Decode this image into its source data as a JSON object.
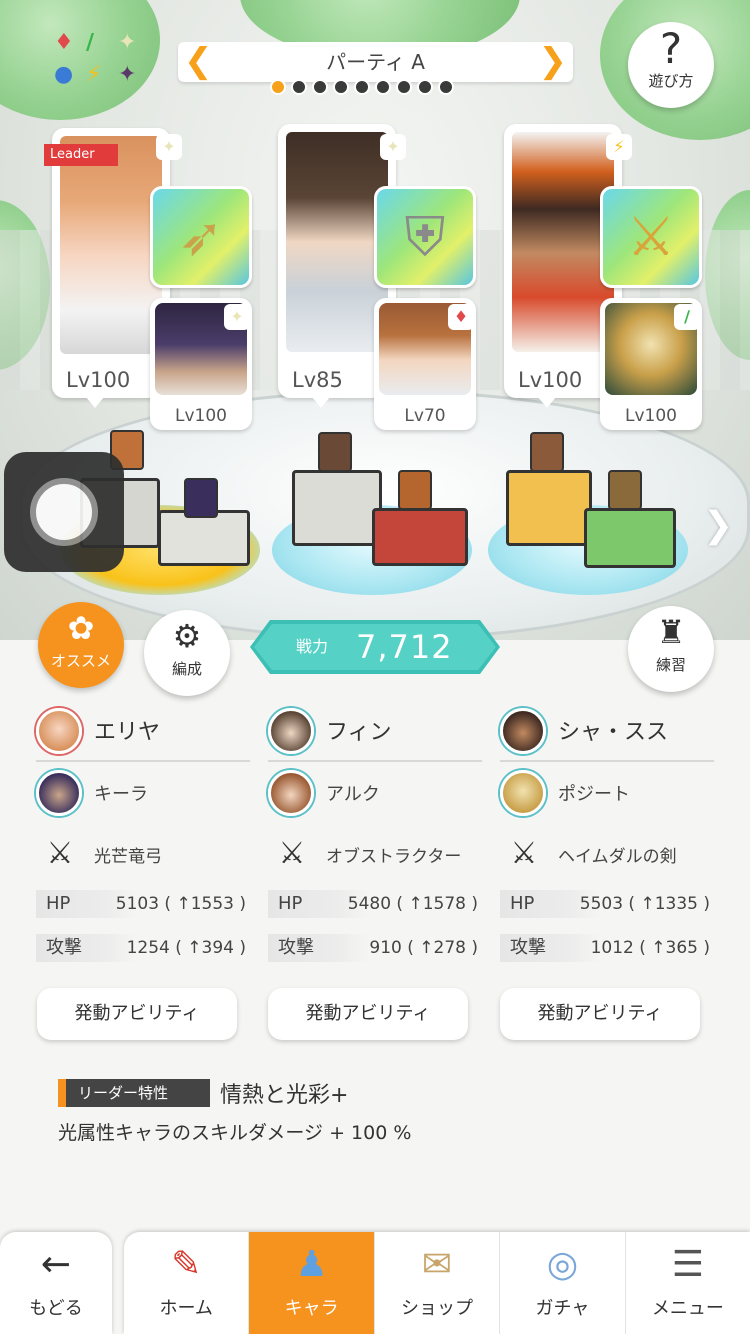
{
  "header": {
    "party_name": "パーティ A",
    "prev_arrow": "❮",
    "next_arrow": "❯",
    "page_count": 9,
    "active_page": 1,
    "help_label": "遊び方",
    "help_icon": "?"
  },
  "element_icons": [
    "♦",
    "∕",
    "✦",
    "●",
    "⚡",
    "✦"
  ],
  "team": [
    {
      "leader_tag": "Leader",
      "main_level": "Lv100",
      "sub_level": "Lv100",
      "colors": {
        "hair": "#d9925e",
        "skin": "#f7d6c2",
        "accent": "#e04a4a"
      }
    },
    {
      "main_level": "Lv85",
      "sub_level": "Lv70",
      "colors": {
        "hair": "#5a4536",
        "skin": "#f0d7c4",
        "accent": "#b8c2cc"
      }
    },
    {
      "main_level": "Lv100",
      "sub_level": "Lv100",
      "colors": {
        "hair": "#3e2a22",
        "skin": "#c28a61",
        "accent": "#d84a2c"
      }
    }
  ],
  "buttons": {
    "osusume": "オススメ",
    "hensei": "編成",
    "renshu": "練習"
  },
  "power": {
    "label": "戦力",
    "value": "7,712"
  },
  "members": [
    {
      "main_name": "エリヤ",
      "sub_name": "キーラ",
      "weapon": "光芒竜弓",
      "hp_label": "HP",
      "hp_value": "5103 ( ↑1553 )",
      "atk_label": "攻撃",
      "atk_value": "1254 ( ↑394 )",
      "ability": "発動アビリティ"
    },
    {
      "main_name": "フィン",
      "sub_name": "アルク",
      "weapon": "オブストラクター",
      "hp_label": "HP",
      "hp_value": "5480 ( ↑1578 )",
      "atk_label": "攻撃",
      "atk_value": "910 ( ↑278 )",
      "ability": "発動アビリティ"
    },
    {
      "main_name": "シャ・スス",
      "sub_name": "ポジート",
      "weapon": "ヘイムダルの剣",
      "hp_label": "HP",
      "hp_value": "5503 ( ↑1335 )",
      "atk_label": "攻撃",
      "atk_value": "1012 ( ↑365 )",
      "ability": "発動アビリティ"
    }
  ],
  "leader_trait": {
    "tag": "リーダー特性",
    "name": "情熱と光彩+",
    "description": "光属性キャラのスキルダメージ + 100 %"
  },
  "nav": {
    "back": "もどる",
    "tabs": [
      "ホーム",
      "キャラ",
      "ショップ",
      "ガチャ",
      "メニュー"
    ],
    "active_tab": "キャラ"
  },
  "colors": {
    "accent": "#f6921e",
    "power": "#3cbfb5"
  }
}
